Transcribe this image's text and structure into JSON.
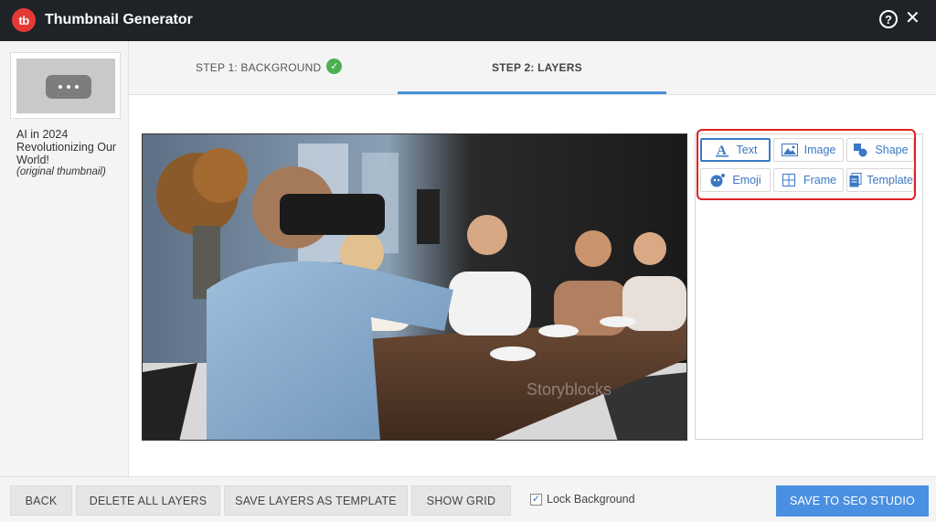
{
  "window": {
    "title": "Thumbnail Generator",
    "logo_text": "tb"
  },
  "sidebar": {
    "video_title": "AI in 2024 Revolutionizing Our World!",
    "caption": "(original thumbnail)"
  },
  "steps": [
    {
      "label": "STEP 1: BACKGROUND",
      "completed": true
    },
    {
      "label": "STEP 2: LAYERS",
      "active": true
    }
  ],
  "canvas": {
    "watermark": "Storyblocks"
  },
  "tools": [
    {
      "label": "Text",
      "icon": "text-icon",
      "active": true
    },
    {
      "label": "Image",
      "icon": "image-icon"
    },
    {
      "label": "Shape",
      "icon": "shape-icon"
    },
    {
      "label": "Emoji",
      "icon": "emoji-icon"
    },
    {
      "label": "Frame",
      "icon": "frame-icon"
    },
    {
      "label": "Template",
      "icon": "template-icon"
    }
  ],
  "footer": {
    "back": "BACK",
    "delete_all": "DELETE ALL LAYERS",
    "save_template": "SAVE LAYERS AS TEMPLATE",
    "show_grid": "SHOW GRID",
    "lock_background": "Lock Background",
    "lock_checked": true,
    "save_seo": "SAVE TO SEO STUDIO"
  },
  "colors": {
    "titlebar": "#1f2328",
    "accent": "#4a90e2",
    "highlight": "#e02020",
    "logo": "#e53935",
    "check": "#4caf50"
  }
}
